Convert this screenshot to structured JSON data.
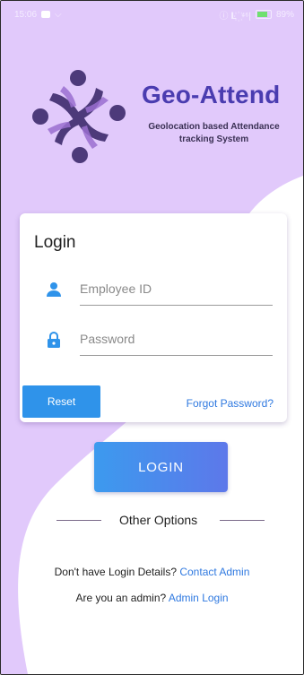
{
  "status_bar": {
    "time": "15:06",
    "right_text": "ⓘ 𝗟 ꙰ ⁴⁶|",
    "battery": "89%"
  },
  "app": {
    "title": "Geo-Attend",
    "subtitle": "Geolocation based Attendance tracking System"
  },
  "login_card": {
    "heading": "Login",
    "employee_id": {
      "placeholder": "Employee ID",
      "value": "",
      "icon": "person-icon"
    },
    "password": {
      "placeholder": "Password",
      "value": "",
      "icon": "lock-icon"
    },
    "reset_label": "Reset",
    "forgot_label": "Forgot Password?"
  },
  "login_button": "LOGIN",
  "other_options": "Other Options",
  "contact_line": {
    "text": "Don't have Login Details?",
    "link": "Contact Admin"
  },
  "admin_line": {
    "text": "Are you an admin?",
    "link": "Admin Login"
  },
  "colors": {
    "background_lavender": "#e1c9fb",
    "background_curve": "#c9a6ef",
    "title_purple": "#4a3cb0",
    "logo_purple": "#4d3a7a",
    "button_blue": "#2f93ea",
    "link_blue": "#2f79e0"
  }
}
